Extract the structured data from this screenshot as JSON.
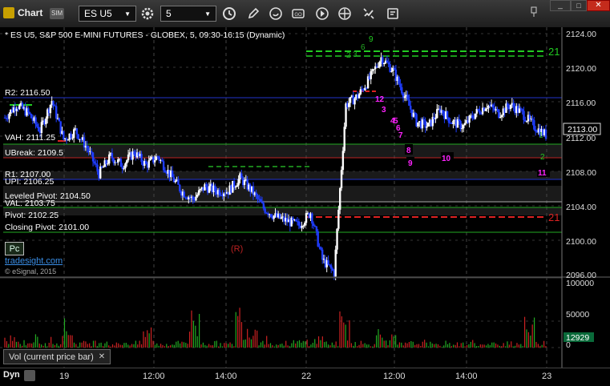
{
  "window": {
    "title": "Chart",
    "badge": "SIM"
  },
  "toolbar": {
    "symbol": "ES U5",
    "interval": "5"
  },
  "chart_title": "* ES U5, S&P 500 E-MINI FUTURES - GLOBEX, 5, 09:30-16:15 (Dynamic)",
  "price_axis": {
    "ticks": [
      "2124.00",
      "2120.00",
      "2116.00",
      "2112.00",
      "2108.00",
      "2104.00",
      "2100.00",
      "2096.00"
    ],
    "last_price": "2113.00"
  },
  "levels": {
    "r2": "R2: 2116.50",
    "vah": "VAH: 2111.25",
    "ubreak": "UBreak: 2109.5",
    "r1": "R1: 2107.00",
    "upi": "UPI: 2106.25",
    "leveled": "Leveled Pivot: 2104.50",
    "val": "VAL: 2103.75",
    "pivot": "Pivot: 2102.25",
    "closing": "Closing Pivot: 2101.00"
  },
  "markers": {
    "green_21": "21",
    "red_21": "21",
    "r_label": "(R)",
    "pc": "Pc",
    "tradesight": "tradesight.com",
    "esignal": "© eSignal, 2015"
  },
  "td_counts": {
    "up_seq": [
      "2",
      "3",
      "6",
      "9"
    ],
    "sell": [
      "12",
      "3",
      "4",
      "5",
      "6",
      "7",
      "8",
      "9",
      "10",
      "11"
    ],
    "misc": [
      "1",
      "2"
    ]
  },
  "volume_panel": {
    "label": "Vol (current price bar)",
    "close_icon": "close-icon",
    "ticks": [
      "100000",
      "50000",
      "0"
    ],
    "last_volume": "12929"
  },
  "x_axis": {
    "labels": [
      "19",
      "12:00",
      "14:00",
      "22",
      "12:00",
      "14:00",
      "23"
    ],
    "dyn": "Dyn"
  },
  "colors": {
    "up": "#ffffff",
    "down": "#1f3dff",
    "r2_line": "#2233cc",
    "green_line": "#22cc22",
    "red_line": "#dd2222"
  },
  "chart_data": {
    "type": "candlestick",
    "title": "* ES U5, S&P 500 E-MINI FUTURES - GLOBEX, 5, 09:30-16:15 (Dynamic)",
    "ylim": [
      2096,
      2125
    ],
    "x_ticks": [
      "19",
      "12:00",
      "14:00",
      "22",
      "12:00",
      "14:00",
      "23"
    ],
    "series": [
      {
        "name": "price_path",
        "values": [
          2114.5,
          2116,
          2115,
          2113,
          2116.5,
          2112,
          2113,
          2111,
          2108,
          2110,
          2109,
          2110.5,
          2109,
          2110,
          2108,
          2106,
          2105,
          2106.5,
          2106,
          2106,
          2107.5,
          2106,
          2104,
          2103,
          2102.5,
          2102,
          2103.5,
          2098,
          2096.5,
          2116,
          2117,
          2119,
          2121.5,
          2120,
          2117,
          2114,
          2113.5,
          2115.5,
          2114,
          2113.5,
          2115,
          2116,
          2115,
          2116,
          2115,
          2113.5,
          2112.5
        ]
      },
      {
        "name": "Vol (current price bar)",
        "values": [
          30000,
          12000,
          20000,
          8000,
          18000,
          45000,
          10000,
          12000,
          15000,
          8000,
          12000,
          10000,
          35000,
          8000,
          9000,
          15000,
          60000,
          12000,
          10000,
          8000,
          70000,
          45000,
          22000,
          8000,
          10000,
          12000,
          15000,
          20000,
          9000,
          55000,
          12000,
          8000,
          30000,
          20000,
          8000,
          10000,
          12000,
          6000,
          10000,
          8000,
          12000,
          6000,
          8000,
          12000,
          10000,
          45000,
          12929
        ]
      }
    ],
    "horizontal_levels": [
      {
        "label": "R2: 2116.50",
        "value": 2116.5
      },
      {
        "label": "VAH: 2111.25",
        "value": 2111.25
      },
      {
        "label": "UBreak: 2109.5",
        "value": 2109.5
      },
      {
        "label": "R1: 2107.00",
        "value": 2107.0
      },
      {
        "label": "UPI: 2106.25",
        "value": 2106.25
      },
      {
        "label": "Leveled Pivot: 2104.50",
        "value": 2104.5
      },
      {
        "label": "VAL: 2103.75",
        "value": 2103.75
      },
      {
        "label": "Pivot: 2102.25",
        "value": 2102.25
      },
      {
        "label": "Closing Pivot: 2101.00",
        "value": 2101.0
      }
    ],
    "last_price": 2113.0,
    "volume_ylim": [
      0,
      100000
    ]
  }
}
